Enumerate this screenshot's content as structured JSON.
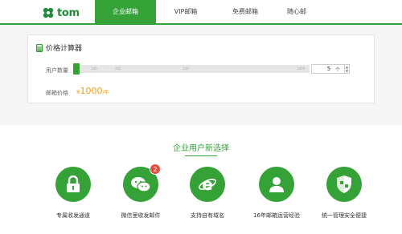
{
  "header": {
    "logo_text": "tom",
    "nav": [
      {
        "label": "企业邮箱",
        "active": true
      },
      {
        "label": "VIP邮箱",
        "active": false
      },
      {
        "label": "免费邮箱",
        "active": false
      },
      {
        "label": "随心邮",
        "active": false
      }
    ]
  },
  "calculator": {
    "title": "价格计算器",
    "user_count_label": "用户数量",
    "slider_ticks": [
      "100",
      "200",
      "500",
      "1000"
    ],
    "user_count_value": "5",
    "user_count_unit": "个",
    "price_label": "邮箱价格",
    "price_currency": "¥",
    "price_value": "1000",
    "price_unit": "/年"
  },
  "features": {
    "title": "企业用户新选择",
    "items": [
      {
        "label": "专属收发通道",
        "icon": "lock-icon"
      },
      {
        "label": "微信里收发邮件",
        "icon": "wechat-icon",
        "badge": "2"
      },
      {
        "label": "支持自有域名",
        "icon": "ie-icon"
      },
      {
        "label": "16年邮箱运营经验",
        "icon": "user-icon"
      },
      {
        "label": "统一管理安全便捷",
        "icon": "shield-icon"
      }
    ]
  },
  "colors": {
    "brand_green": "#34a236",
    "price_orange": "#f39c12",
    "badge_red": "#e74c3c"
  }
}
